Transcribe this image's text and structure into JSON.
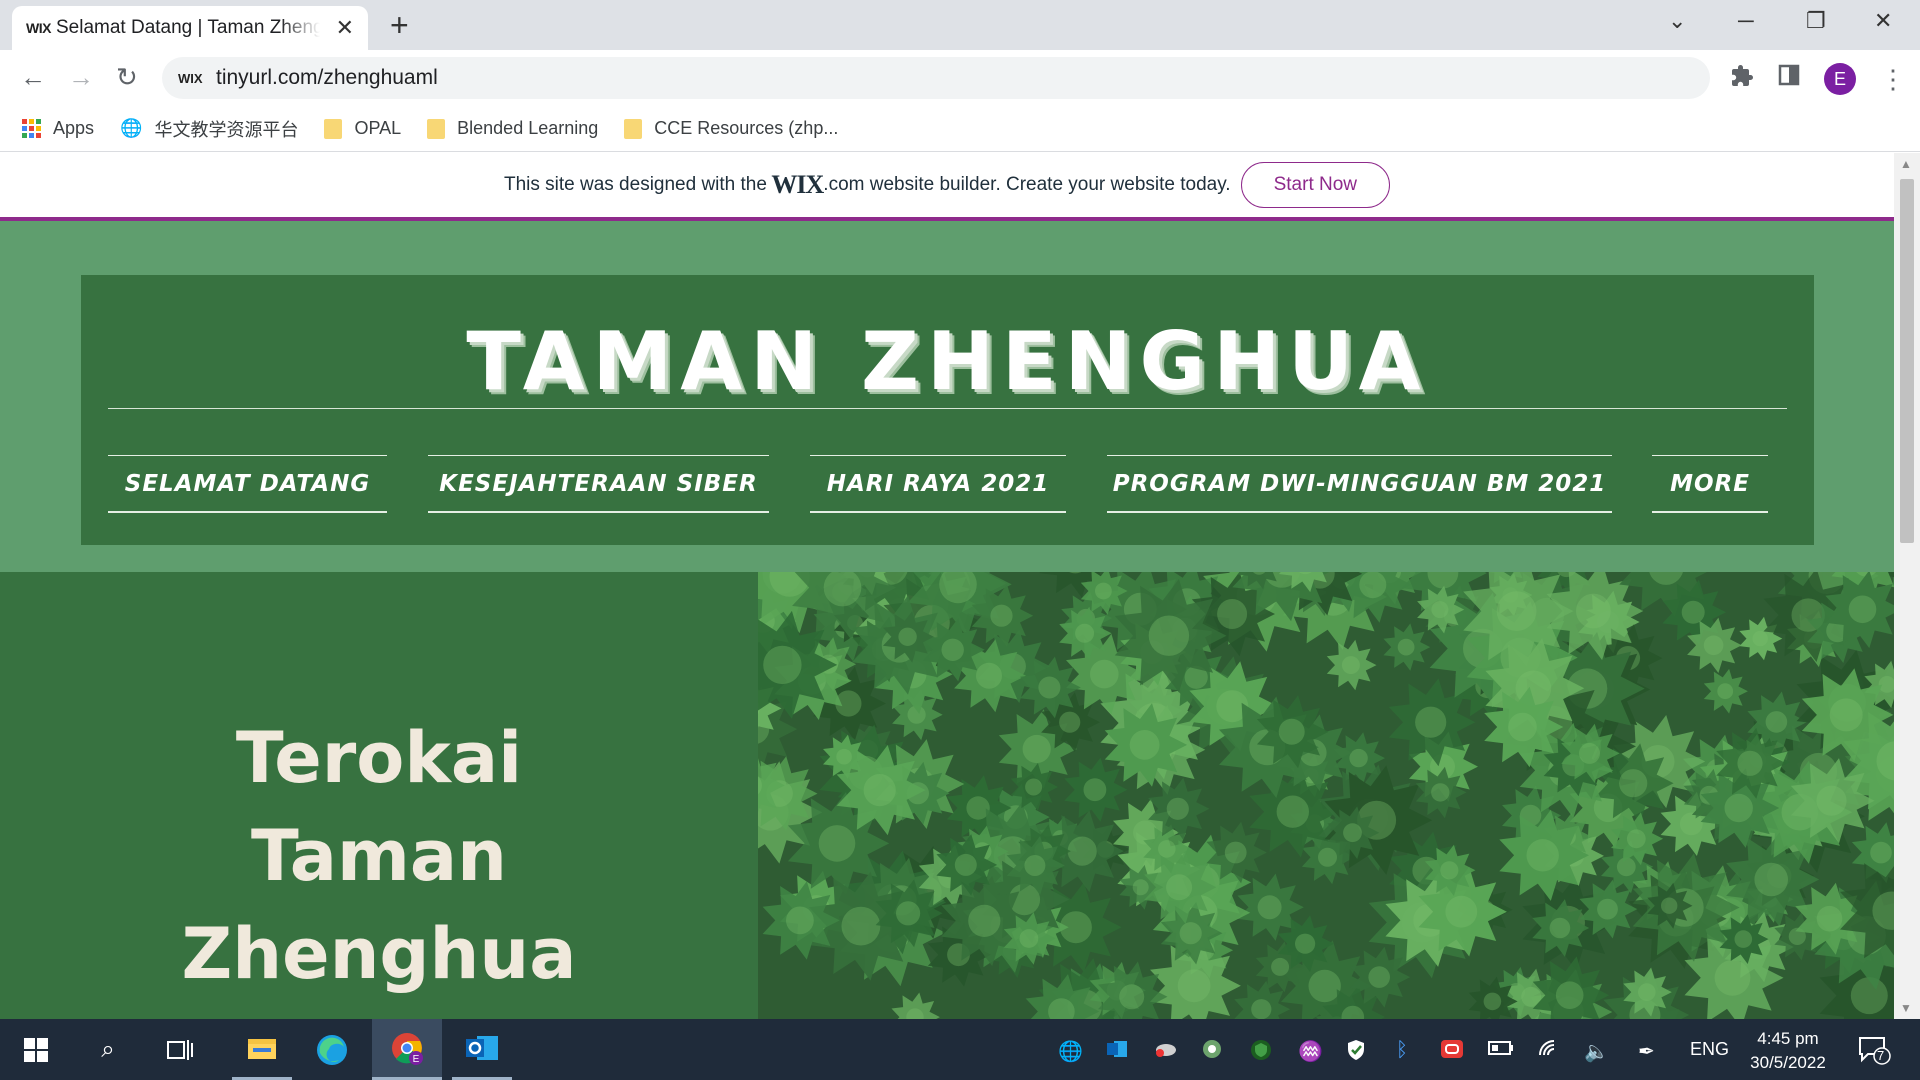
{
  "browser": {
    "tab_favicon": "WIX",
    "tab_title": "Selamat Datang | Taman Zhenghua",
    "address_site_icon": "WIX",
    "url": "tinyurl.com/zhenghuaml",
    "profile_initial": "E",
    "bookmarks": [
      {
        "label": "Apps",
        "icon": "apps-grid-icon"
      },
      {
        "label": "华文教学资源平台",
        "icon": "globe-icon"
      },
      {
        "label": "OPAL",
        "icon": "folder-icon"
      },
      {
        "label": "Blended Learning",
        "icon": "folder-icon"
      },
      {
        "label": "CCE Resources (zhp...",
        "icon": "folder-icon"
      }
    ]
  },
  "wix_banner": {
    "text_before": "This site was designed with the",
    "brand": "WIX",
    "text_after": ".com website builder. Create your website today.",
    "button": "Start Now",
    "accent_color": "#8e2a8b"
  },
  "site": {
    "title": "TAMAN ZHENGHUA",
    "nav": [
      "SELAMAT DATANG",
      "KESEJAHTERAAN SIBER",
      "HARI RAYA 2021",
      "PROGRAM DWI-MINGGUAN BM 2021",
      "MORE"
    ],
    "hero_lines": [
      "Terokai",
      "Taman",
      "Zhenghua"
    ],
    "colors": {
      "header_bg": "#377240",
      "page_bg": "#5f9e6e",
      "hero_text": "#f0e9dc"
    }
  },
  "taskbar": {
    "time": "4:45 pm",
    "date": "30/5/2022",
    "language": "ENG",
    "notifications": "7"
  }
}
